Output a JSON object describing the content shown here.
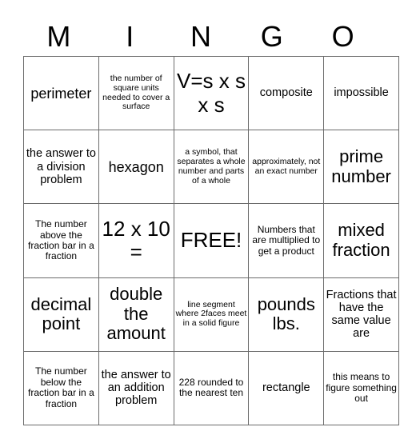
{
  "header": {
    "letters": [
      "M",
      "I",
      "N",
      "G",
      "O"
    ]
  },
  "grid": {
    "rows": [
      [
        {
          "text": "perimeter",
          "size": "sz-l"
        },
        {
          "text": "the number of square units needed to cover a surface",
          "size": "sz-xs"
        },
        {
          "text": "V=s x s x s",
          "size": "sz-xxl"
        },
        {
          "text": "composite",
          "size": "sz-m"
        },
        {
          "text": "impossible",
          "size": "sz-m"
        }
      ],
      [
        {
          "text": "the answer to a division problem",
          "size": "sz-m"
        },
        {
          "text": "hexagon",
          "size": "sz-l"
        },
        {
          "text": "a symbol, that separates a whole number and parts of a whole",
          "size": "sz-xs"
        },
        {
          "text": "approximately, not an exact number",
          "size": "sz-xs"
        },
        {
          "text": "prime number",
          "size": "sz-xl"
        }
      ],
      [
        {
          "text": "The number above the fraction bar in a fraction",
          "size": "sz-s"
        },
        {
          "text": "12 x 10 =",
          "size": "sz-xxl"
        },
        {
          "text": "FREE!",
          "size": "sz-xxl"
        },
        {
          "text": "Numbers that are multiplied to get a product",
          "size": "sz-s"
        },
        {
          "text": "mixed fraction",
          "size": "sz-xl"
        }
      ],
      [
        {
          "text": "decimal point",
          "size": "sz-xl"
        },
        {
          "text": "double the amount",
          "size": "sz-xl"
        },
        {
          "text": "line segment where 2faces meet in a solid figure",
          "size": "sz-xs"
        },
        {
          "text": "pounds lbs.",
          "size": "sz-xl"
        },
        {
          "text": "Fractions that have the same value are",
          "size": "sz-m"
        }
      ],
      [
        {
          "text": "The number below the fraction bar in a fraction",
          "size": "sz-s"
        },
        {
          "text": "the answer to an addition problem",
          "size": "sz-m"
        },
        {
          "text": "228 rounded to the nearest ten",
          "size": "sz-s"
        },
        {
          "text": "rectangle",
          "size": "sz-m"
        },
        {
          "text": "this means to figure something out",
          "size": "sz-s"
        }
      ]
    ]
  },
  "colors": {
    "background": "#ffffff",
    "text": "#000000",
    "grid_line": "#6b6b6b"
  }
}
